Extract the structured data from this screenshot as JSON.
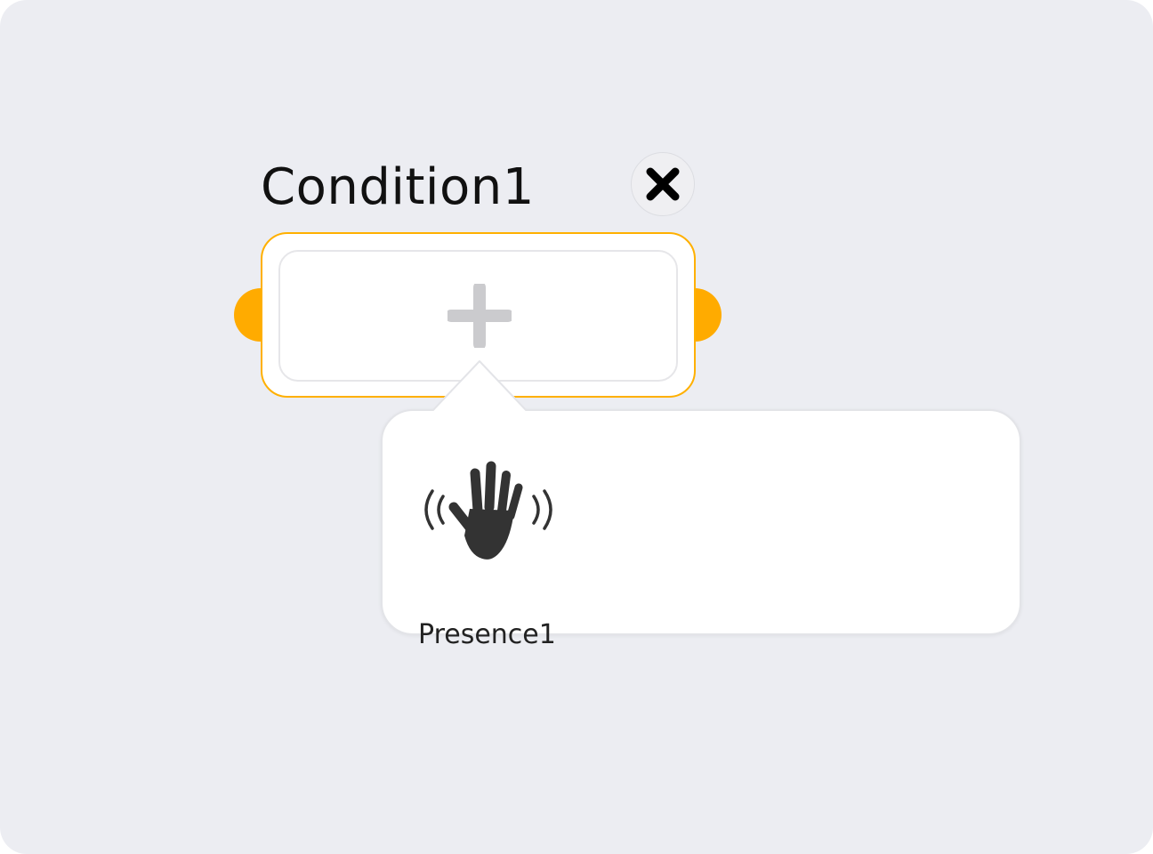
{
  "condition": {
    "title": "Condition1",
    "close_icon": "close-icon",
    "add_icon": "plus-icon",
    "accent_color": "#ffab00"
  },
  "popover": {
    "items": [
      {
        "label": "Presence1",
        "icon": "presence-hand-icon"
      }
    ]
  }
}
